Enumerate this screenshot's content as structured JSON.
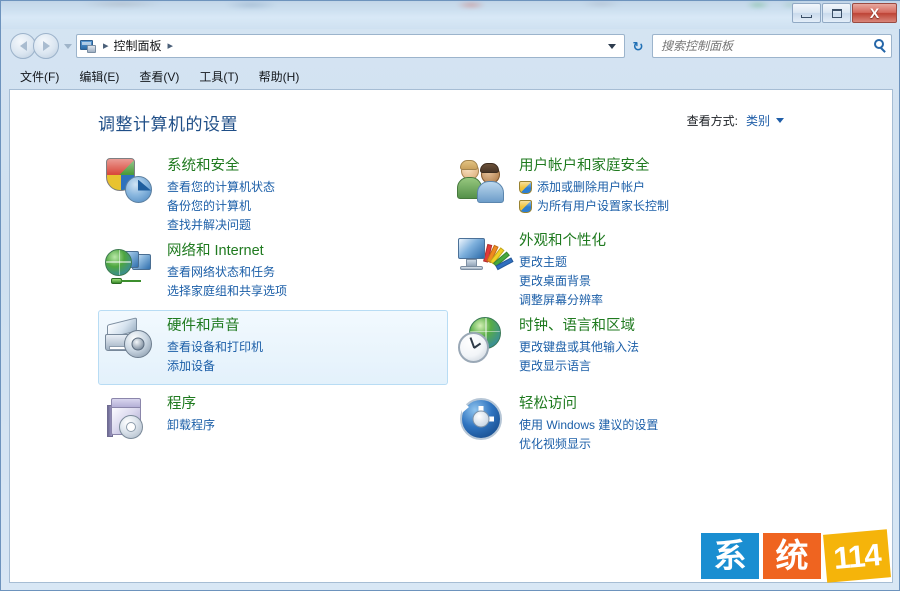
{
  "window": {
    "buttons": {
      "minimize": "–",
      "maximize": "□",
      "close": "X"
    }
  },
  "navbar": {
    "back_label": "后退",
    "forward_label": "前进",
    "breadcrumb_root": "控制面板",
    "breadcrumb_separator": "▸",
    "refresh_glyph": "↻",
    "dropdown_glyph": "▾"
  },
  "search": {
    "placeholder": "搜索控制面板",
    "value": ""
  },
  "menubar": {
    "items": [
      {
        "label": "文件(F)"
      },
      {
        "label": "编辑(E)"
      },
      {
        "label": "查看(V)"
      },
      {
        "label": "工具(T)"
      },
      {
        "label": "帮助(H)"
      }
    ]
  },
  "main": {
    "page_title": "调整计算机的设置",
    "view_by_label": "查看方式:",
    "view_by_value": "类别"
  },
  "categories": {
    "left": [
      {
        "title": "系统和安全",
        "icon": "security-shield-icon",
        "links": [
          {
            "label": "查看您的计算机状态",
            "shield": false
          },
          {
            "label": "备份您的计算机",
            "shield": false
          },
          {
            "label": "查找并解决问题",
            "shield": false
          }
        ],
        "highlighted": false
      },
      {
        "title": "网络和 Internet",
        "icon": "network-globe-icon",
        "links": [
          {
            "label": "查看网络状态和任务",
            "shield": false
          },
          {
            "label": "选择家庭组和共享选项",
            "shield": false
          }
        ],
        "highlighted": false
      },
      {
        "title": "硬件和声音",
        "icon": "printer-device-icon",
        "links": [
          {
            "label": "查看设备和打印机",
            "shield": false
          },
          {
            "label": "添加设备",
            "shield": false
          }
        ],
        "highlighted": true
      },
      {
        "title": "程序",
        "icon": "program-box-icon",
        "links": [
          {
            "label": "卸载程序",
            "shield": false
          }
        ],
        "highlighted": false
      }
    ],
    "right": [
      {
        "title": "用户帐户和家庭安全",
        "icon": "users-icon",
        "links": [
          {
            "label": "添加或删除用户帐户",
            "shield": true
          },
          {
            "label": "为所有用户设置家长控制",
            "shield": true
          }
        ],
        "highlighted": false
      },
      {
        "title": "外观和个性化",
        "icon": "appearance-monitor-icon",
        "links": [
          {
            "label": "更改主题",
            "shield": false
          },
          {
            "label": "更改桌面背景",
            "shield": false
          },
          {
            "label": "调整屏幕分辨率",
            "shield": false
          }
        ],
        "highlighted": false
      },
      {
        "title": "时钟、语言和区域",
        "icon": "clock-globe-icon",
        "links": [
          {
            "label": "更改键盘或其他输入法",
            "shield": false
          },
          {
            "label": "更改显示语言",
            "shield": false
          }
        ],
        "highlighted": false
      },
      {
        "title": "轻松访问",
        "icon": "ease-of-access-icon",
        "links": [
          {
            "label": "使用 Windows 建议的设置",
            "shield": false
          },
          {
            "label": "优化视频显示",
            "shield": false
          }
        ],
        "highlighted": false
      }
    ]
  },
  "watermark": {
    "part1": "系",
    "part2": "统",
    "part3": "114",
    "color1": "#1a8ed1",
    "color2": "#ef6420",
    "color3": "#f5b40a"
  },
  "colors": {
    "category_title": "#1f7a1f",
    "link": "#1c5fa8",
    "page_title": "#1f4e87",
    "highlight_bg": "#e3f1fb",
    "highlight_border": "#b8dcf4"
  }
}
